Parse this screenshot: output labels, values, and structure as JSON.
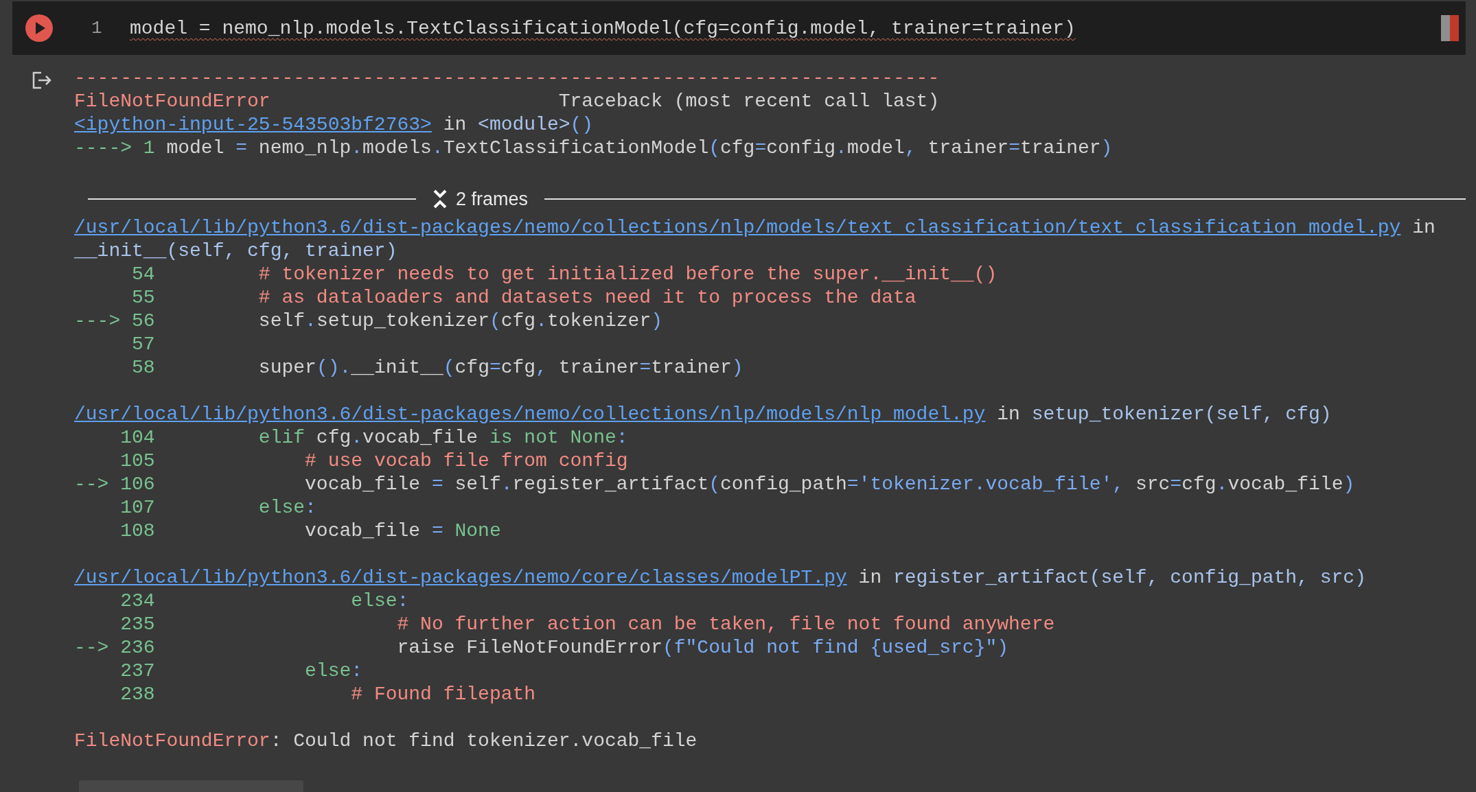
{
  "cell": {
    "line_number": "1",
    "lint_error": true,
    "code": [
      {
        "kind": "plain",
        "text": "model = nemo_nlp.models.TextClassificationModel(cfg=config.model, trainer=trainer)"
      }
    ]
  },
  "output": {
    "header": [
      {
        "tokens": [
          {
            "kind": "red",
            "text": "---------------------------------------------------------------------------"
          }
        ]
      },
      {
        "tokens": [
          {
            "kind": "red",
            "text": "FileNotFoundError"
          },
          {
            "kind": "plain",
            "text": "                         Traceback (most recent call last)"
          }
        ]
      },
      {
        "tokens": [
          {
            "kind": "link",
            "text": "<ipython-input-25-543503bf2763>"
          },
          {
            "kind": "plain",
            "text": " in "
          },
          {
            "kind": "name",
            "text": "<module>"
          },
          {
            "kind": "op",
            "text": "()"
          }
        ]
      },
      {
        "tokens": [
          {
            "kind": "green",
            "text": "----> 1 "
          },
          {
            "kind": "plain",
            "text": "model "
          },
          {
            "kind": "op",
            "text": "= "
          },
          {
            "kind": "plain",
            "text": "nemo_nlp"
          },
          {
            "kind": "op",
            "text": "."
          },
          {
            "kind": "plain",
            "text": "models"
          },
          {
            "kind": "op",
            "text": "."
          },
          {
            "kind": "plain",
            "text": "TextClassificationModel"
          },
          {
            "kind": "op",
            "text": "("
          },
          {
            "kind": "plain",
            "text": "cfg"
          },
          {
            "kind": "op",
            "text": "="
          },
          {
            "kind": "plain",
            "text": "config"
          },
          {
            "kind": "op",
            "text": "."
          },
          {
            "kind": "plain",
            "text": "model"
          },
          {
            "kind": "op",
            "text": ", "
          },
          {
            "kind": "plain",
            "text": "trainer"
          },
          {
            "kind": "op",
            "text": "="
          },
          {
            "kind": "plain",
            "text": "trainer"
          },
          {
            "kind": "op",
            "text": ")"
          }
        ]
      }
    ],
    "frames": {
      "label": "2 frames",
      "expanded": true
    },
    "trace": [
      {
        "tokens": [
          {
            "kind": "link",
            "text": "/usr/local/lib/python3.6/dist-packages/nemo/collections/nlp/models/text_classification/text_classification_model.py"
          },
          {
            "kind": "plain",
            "text": " in"
          }
        ]
      },
      {
        "tokens": [
          {
            "kind": "name",
            "text": "__init__(self, cfg, trainer)"
          }
        ]
      },
      {
        "tokens": [
          {
            "kind": "green",
            "text": "     54"
          },
          {
            "kind": "red",
            "text": "         # tokenizer needs to get initialized before the super.__init__()"
          }
        ]
      },
      {
        "tokens": [
          {
            "kind": "green",
            "text": "     55"
          },
          {
            "kind": "red",
            "text": "         # as dataloaders and datasets need it to process the data"
          }
        ]
      },
      {
        "tokens": [
          {
            "kind": "green",
            "text": "---> 56"
          },
          {
            "kind": "plain",
            "text": "         self"
          },
          {
            "kind": "op",
            "text": "."
          },
          {
            "kind": "plain",
            "text": "setup_tokenizer"
          },
          {
            "kind": "op",
            "text": "("
          },
          {
            "kind": "plain",
            "text": "cfg"
          },
          {
            "kind": "op",
            "text": "."
          },
          {
            "kind": "plain",
            "text": "tokenizer"
          },
          {
            "kind": "op",
            "text": ")"
          }
        ]
      },
      {
        "tokens": [
          {
            "kind": "green",
            "text": "     57"
          }
        ]
      },
      {
        "tokens": [
          {
            "kind": "green",
            "text": "     58"
          },
          {
            "kind": "plain",
            "text": "         super"
          },
          {
            "kind": "op",
            "text": "()."
          },
          {
            "kind": "plain",
            "text": "__init__"
          },
          {
            "kind": "op",
            "text": "("
          },
          {
            "kind": "plain",
            "text": "cfg"
          },
          {
            "kind": "op",
            "text": "="
          },
          {
            "kind": "plain",
            "text": "cfg"
          },
          {
            "kind": "op",
            "text": ", "
          },
          {
            "kind": "plain",
            "text": "trainer"
          },
          {
            "kind": "op",
            "text": "="
          },
          {
            "kind": "plain",
            "text": "trainer"
          },
          {
            "kind": "op",
            "text": ")"
          }
        ]
      },
      {
        "blank_before": true,
        "tokens": [
          {
            "kind": "link",
            "text": "/usr/local/lib/python3.6/dist-packages/nemo/collections/nlp/models/nlp_model.py"
          },
          {
            "kind": "plain",
            "text": " in "
          },
          {
            "kind": "name",
            "text": "setup_tokenizer(self, cfg)"
          }
        ]
      },
      {
        "tokens": [
          {
            "kind": "green",
            "text": "    104"
          },
          {
            "kind": "green",
            "text": "         elif"
          },
          {
            "kind": "plain",
            "text": " cfg"
          },
          {
            "kind": "op",
            "text": "."
          },
          {
            "kind": "plain",
            "text": "vocab_file "
          },
          {
            "kind": "green",
            "text": "is not None"
          },
          {
            "kind": "op",
            "text": ":"
          }
        ]
      },
      {
        "tokens": [
          {
            "kind": "green",
            "text": "    105"
          },
          {
            "kind": "red",
            "text": "             # use vocab file from config"
          }
        ]
      },
      {
        "tokens": [
          {
            "kind": "green",
            "text": "--> 106"
          },
          {
            "kind": "plain",
            "text": "             vocab_file "
          },
          {
            "kind": "op",
            "text": "="
          },
          {
            "kind": "plain",
            "text": " self"
          },
          {
            "kind": "op",
            "text": "."
          },
          {
            "kind": "plain",
            "text": "register_artifact"
          },
          {
            "kind": "op",
            "text": "("
          },
          {
            "kind": "plain",
            "text": "config_path"
          },
          {
            "kind": "op",
            "text": "="
          },
          {
            "kind": "string",
            "text": "'tokenizer.vocab_file'"
          },
          {
            "kind": "op",
            "text": ", "
          },
          {
            "kind": "plain",
            "text": "src"
          },
          {
            "kind": "op",
            "text": "="
          },
          {
            "kind": "plain",
            "text": "cfg"
          },
          {
            "kind": "op",
            "text": "."
          },
          {
            "kind": "plain",
            "text": "vocab_file"
          },
          {
            "kind": "op",
            "text": ")"
          }
        ]
      },
      {
        "tokens": [
          {
            "kind": "green",
            "text": "    107"
          },
          {
            "kind": "green",
            "text": "         else"
          },
          {
            "kind": "op",
            "text": ":"
          }
        ]
      },
      {
        "tokens": [
          {
            "kind": "green",
            "text": "    108"
          },
          {
            "kind": "plain",
            "text": "             vocab_file "
          },
          {
            "kind": "op",
            "text": "="
          },
          {
            "kind": "green",
            "text": " None"
          }
        ]
      },
      {
        "blank_before": true,
        "tokens": [
          {
            "kind": "link",
            "text": "/usr/local/lib/python3.6/dist-packages/nemo/core/classes/modelPT.py"
          },
          {
            "kind": "plain",
            "text": " in "
          },
          {
            "kind": "name",
            "text": "register_artifact(self, config_path, src)"
          }
        ]
      },
      {
        "tokens": [
          {
            "kind": "green",
            "text": "    234"
          },
          {
            "kind": "green",
            "text": "                 else"
          },
          {
            "kind": "op",
            "text": ":"
          }
        ]
      },
      {
        "tokens": [
          {
            "kind": "green",
            "text": "    235"
          },
          {
            "kind": "red",
            "text": "                     # No further action can be taken, file not found anywhere"
          }
        ]
      },
      {
        "tokens": [
          {
            "kind": "green",
            "text": "--> 236"
          },
          {
            "kind": "plain",
            "text": "                     raise FileNotFoundError"
          },
          {
            "kind": "op",
            "text": "("
          },
          {
            "kind": "string",
            "text": "f\"Could not find {used_src}\""
          },
          {
            "kind": "op",
            "text": ")"
          }
        ]
      },
      {
        "tokens": [
          {
            "kind": "green",
            "text": "    237"
          },
          {
            "kind": "green",
            "text": "             else"
          },
          {
            "kind": "op",
            "text": ":"
          }
        ]
      },
      {
        "tokens": [
          {
            "kind": "green",
            "text": "    238"
          },
          {
            "kind": "red",
            "text": "                 # Found filepath"
          }
        ]
      },
      {
        "blank_before": true,
        "tokens": [
          {
            "kind": "red",
            "text": "FileNotFoundError"
          },
          {
            "kind": "plain",
            "text": ": Could not find tokenizer.vocab_file"
          }
        ]
      }
    ]
  }
}
